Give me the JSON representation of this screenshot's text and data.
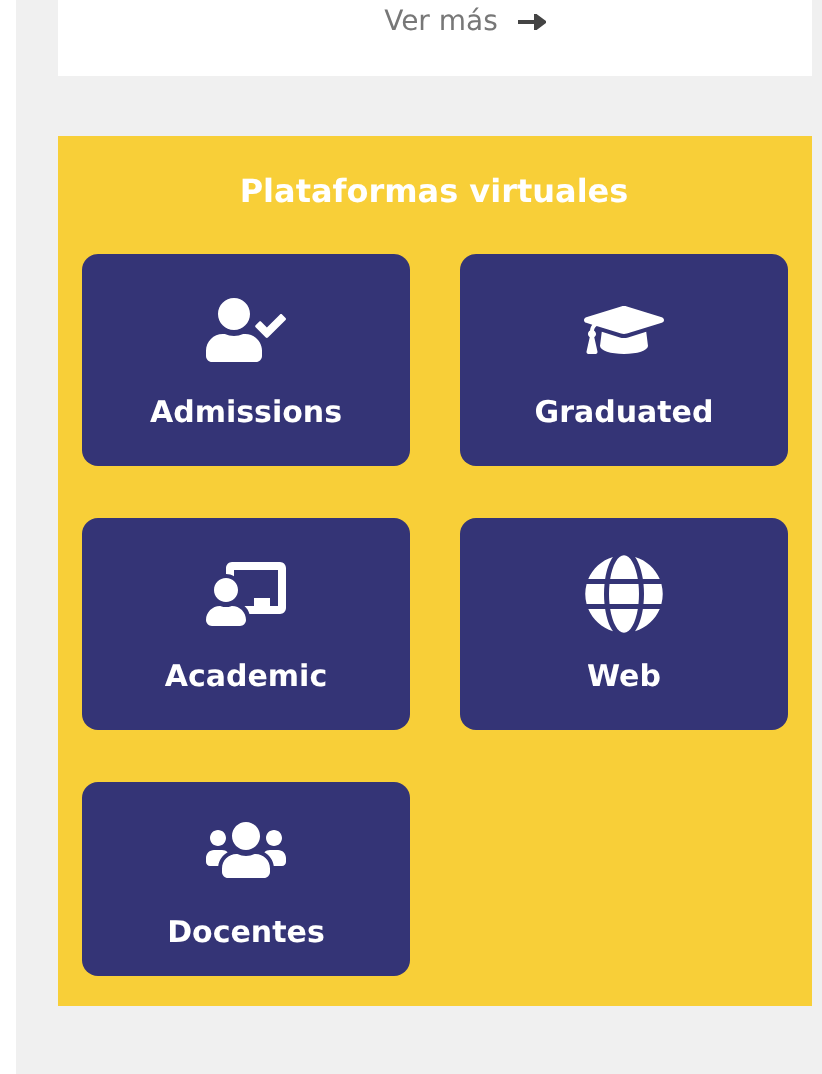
{
  "more_link": {
    "label": "Ver más"
  },
  "platforms": {
    "title": "Plataformas virtuales",
    "tiles": [
      {
        "label": "Admissions"
      },
      {
        "label": "Graduated"
      },
      {
        "label": "Academic"
      },
      {
        "label": "Web"
      },
      {
        "label": "Docentes"
      }
    ]
  }
}
